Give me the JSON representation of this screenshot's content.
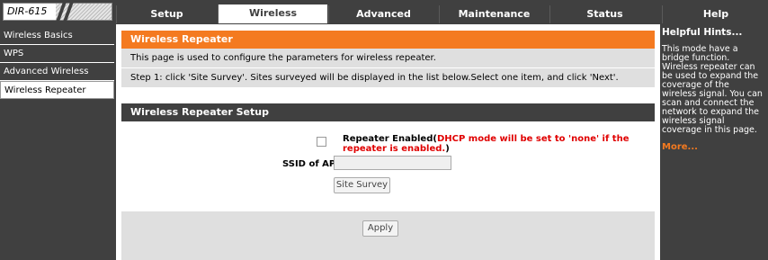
{
  "header": {
    "model": "DIR-615",
    "tabs": [
      {
        "label": "Setup"
      },
      {
        "label": "Wireless"
      },
      {
        "label": "Advanced"
      },
      {
        "label": "Maintenance"
      },
      {
        "label": "Status"
      },
      {
        "label": "Help"
      }
    ],
    "active_tab": "Wireless"
  },
  "sidebar": {
    "items": [
      {
        "label": "Wireless Basics"
      },
      {
        "label": "WPS"
      },
      {
        "label": "Advanced Wireless"
      },
      {
        "label": "Wireless Repeater"
      }
    ],
    "active_item": "Wireless Repeater"
  },
  "main": {
    "section_title": "Wireless Repeater",
    "intro": "This page is used to configure the parameters for wireless repeater.",
    "step": "Step 1: click 'Site Survey'. Sites surveyed will be displayed in the list below.Select one item, and click 'Next'.",
    "setup_title": "Wireless Repeater Setup",
    "repeater_enabled_label": "Repeater Enabled(",
    "repeater_warning": "DHCP mode will be set to 'none' if the repeater is enabled.",
    "repeater_close": ")",
    "repeater_checked": false,
    "ssid_label": "SSID of AP",
    "ssid_value": "",
    "site_survey_button": "Site Survey",
    "apply_button": "Apply"
  },
  "hints": {
    "title": "Helpful Hints...",
    "body": "This mode have a bridge function. Wireless repeater can be used to expand the coverage of the wireless signal. You can scan and connect the network to expand the wireless signal coverage in this page.",
    "more": "More..."
  },
  "colors": {
    "dark": "#404040",
    "accent": "#f47a20",
    "panel": "#dfdfdf",
    "warning": "#e00000"
  }
}
